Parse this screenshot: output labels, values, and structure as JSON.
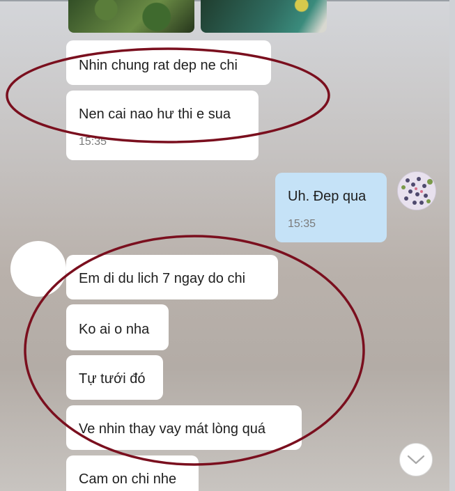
{
  "messages": {
    "received_group_1": [
      {
        "text": "Nhin chung rat dep ne chi"
      },
      {
        "text": "Nen cai nao hư thi e sua",
        "time": "15:35"
      }
    ],
    "sent": {
      "text": "Uh. Đep qua",
      "time": "15:35"
    },
    "received_group_2": [
      {
        "text": "Em di du lich 7 ngay do chi"
      },
      {
        "text": "Ko ai o nha"
      },
      {
        "text": "Tự tưới đó"
      },
      {
        "text": "Ve nhin thay vay mát lòng quá"
      },
      {
        "text": "Cam on chi nhe"
      }
    ]
  },
  "icons": {
    "scroll_down": "chevron-down-icon",
    "my_avatar": "avatar",
    "other_avatar": "avatar"
  },
  "colors": {
    "sent_bubble": "#c5e2f7",
    "received_bubble": "#ffffff",
    "annotation_ellipse": "#7a0f1e"
  }
}
